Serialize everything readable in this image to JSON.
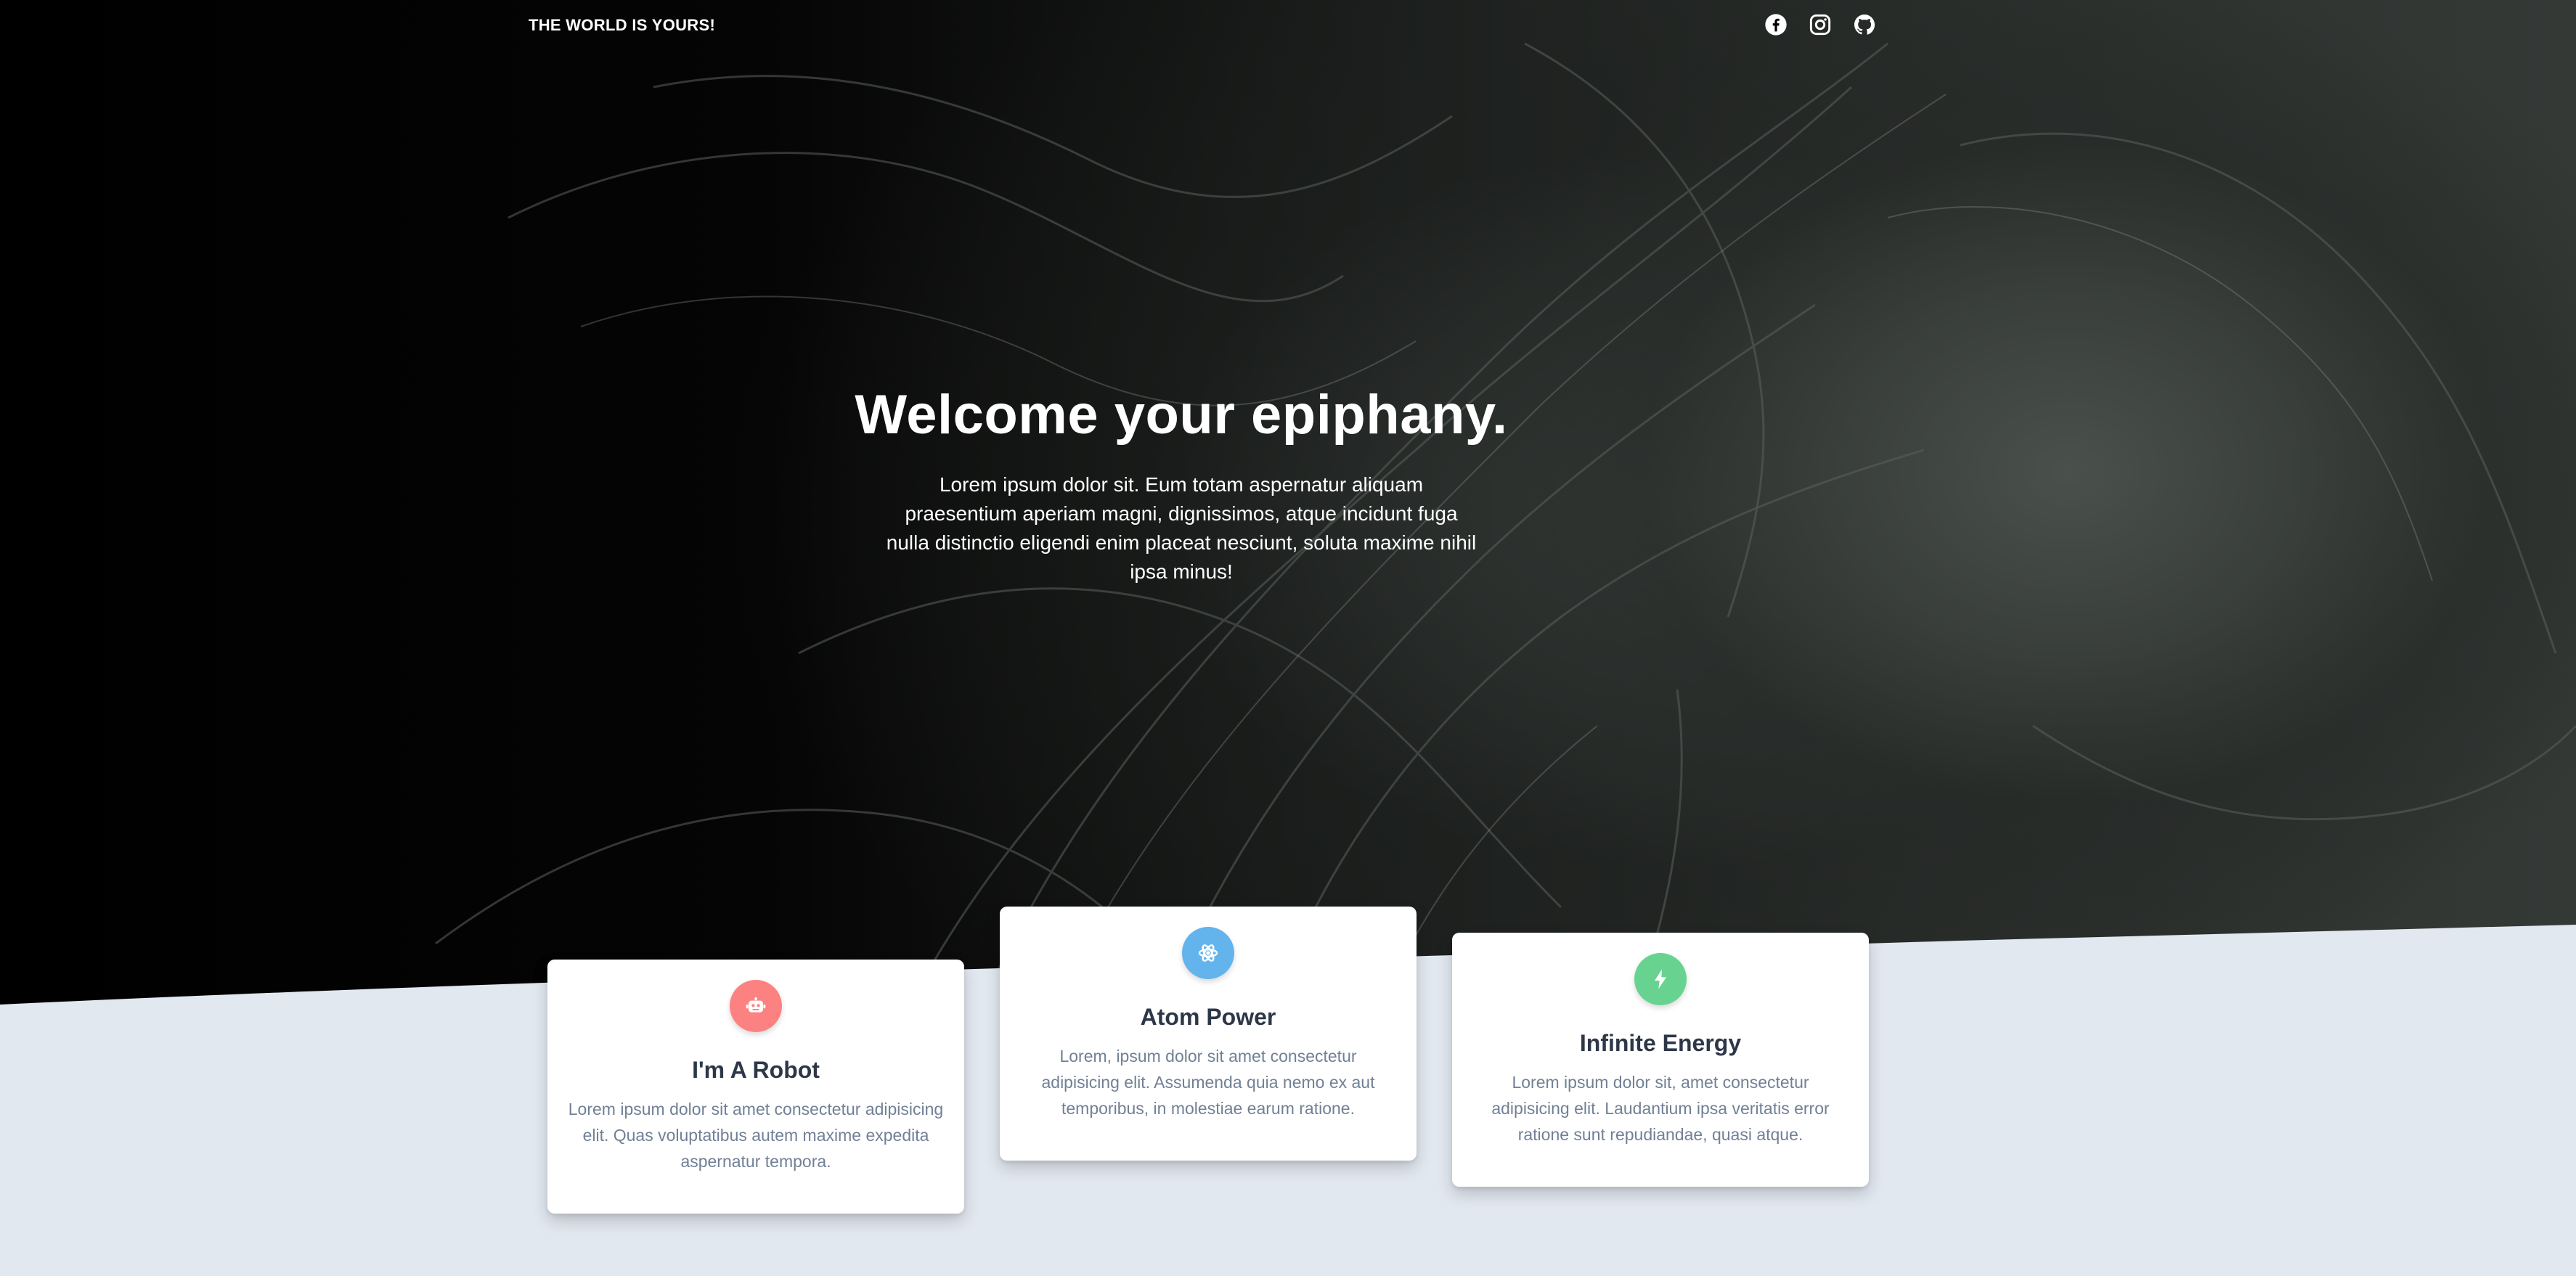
{
  "nav": {
    "brand": "THE WORLD IS YOURS!",
    "social": [
      {
        "icon": "facebook-icon"
      },
      {
        "icon": "instagram-icon"
      },
      {
        "icon": "github-icon"
      }
    ]
  },
  "hero": {
    "title": "Welcome your epiphany.",
    "text": "Lorem ipsum dolor sit. Eum totam aspernatur aliquam praesentium aperiam magni, dignissimos, atque incidunt fuga nulla distinctio eligendi enim placeat nesciunt, soluta maxime nihil ipsa minus!"
  },
  "cards": [
    {
      "title": "I'm A Robot",
      "text": "Lorem ipsum dolor sit amet consectetur adipisicing elit. Quas voluptatibus autem maxime expedita aspernatur tempora.",
      "icon": "robot-icon",
      "color": "#fc8181"
    },
    {
      "title": "Atom Power",
      "text": "Lorem, ipsum dolor sit amet consectetur adipisicing elit. Assumenda quia nemo ex aut temporibus, in molestiae earum ratione.",
      "icon": "atom-icon",
      "color": "#63b3ed"
    },
    {
      "title": "Infinite Energy",
      "text": "Lorem ipsum dolor sit, amet consectetur adipisicing elit. Laudantium ipsa veritatis error ratione sunt repudiandae, quasi atque.",
      "icon": "bolt-icon",
      "color": "#68d391"
    }
  ],
  "colors": {
    "hero_bg": "#000000",
    "page_bg": "#e2e8f0",
    "card_title": "#2d3748",
    "card_text": "#718096"
  }
}
